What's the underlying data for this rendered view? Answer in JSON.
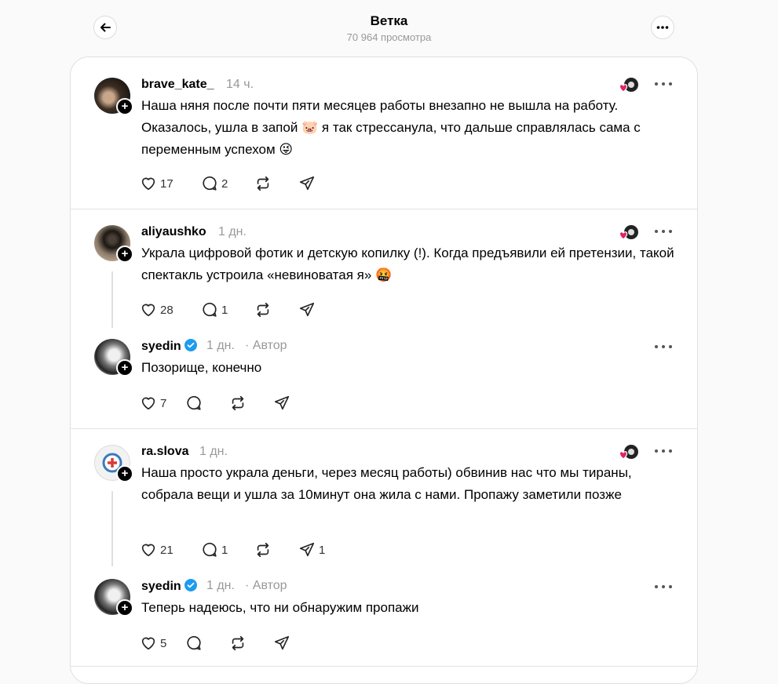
{
  "header": {
    "title": "Ветка",
    "views": "70 964 просмотра"
  },
  "icons": {
    "back": "arrow-left-icon",
    "more": "ellipsis-icon",
    "like": "heart-icon",
    "reply": "speech-bubble-icon",
    "repost": "repost-icon",
    "share": "paper-plane-icon",
    "follow": "plus-icon",
    "verified": "verified-badge-icon"
  },
  "colors": {
    "verified": "#1d9bf0",
    "like_heart": "#e0245e",
    "muted": "#999999"
  },
  "posts": [
    {
      "username": "brave_kate_",
      "time": "14 ч.",
      "text": "Наша няня после почти пяти месяцев работы внезапно не вышла на работу. Оказалось, ушла в запой 🐷 я так стрессанула, что дальше справлялась сама с переменным успехом 😜",
      "likes": "17",
      "replies": "2",
      "reposts": "",
      "shares": ""
    },
    {
      "username": "aliyaushko",
      "time": "1 дн.",
      "text": "Украла цифровой фотик и детскую копилку (!). Когда предъявили ей претензии, такой спектакль устроила «невиноватая я» 🤬",
      "likes": "28",
      "replies": "1",
      "reposts": "",
      "shares": ""
    },
    {
      "username": "syedin",
      "time": "1 дн.",
      "author_label": "· Автор",
      "text": "Позорище, конечно",
      "likes": "7",
      "replies": "",
      "reposts": "",
      "shares": ""
    },
    {
      "username": "ra.slova",
      "time": "1 дн.",
      "text": "Наша просто украла деньги, через месяц работы) обвинив нас что мы тираны, собрала вещи и ушла за 10минут она жила с нами. Пропажу заметили позже",
      "likes": "21",
      "replies": "1",
      "reposts": "",
      "shares": "1"
    },
    {
      "username": "syedin",
      "time": "1 дн.",
      "author_label": "· Автор",
      "text": "Теперь надеюсь, что ни обнаружим пропажи",
      "likes": "5",
      "replies": "",
      "reposts": "",
      "shares": ""
    }
  ]
}
